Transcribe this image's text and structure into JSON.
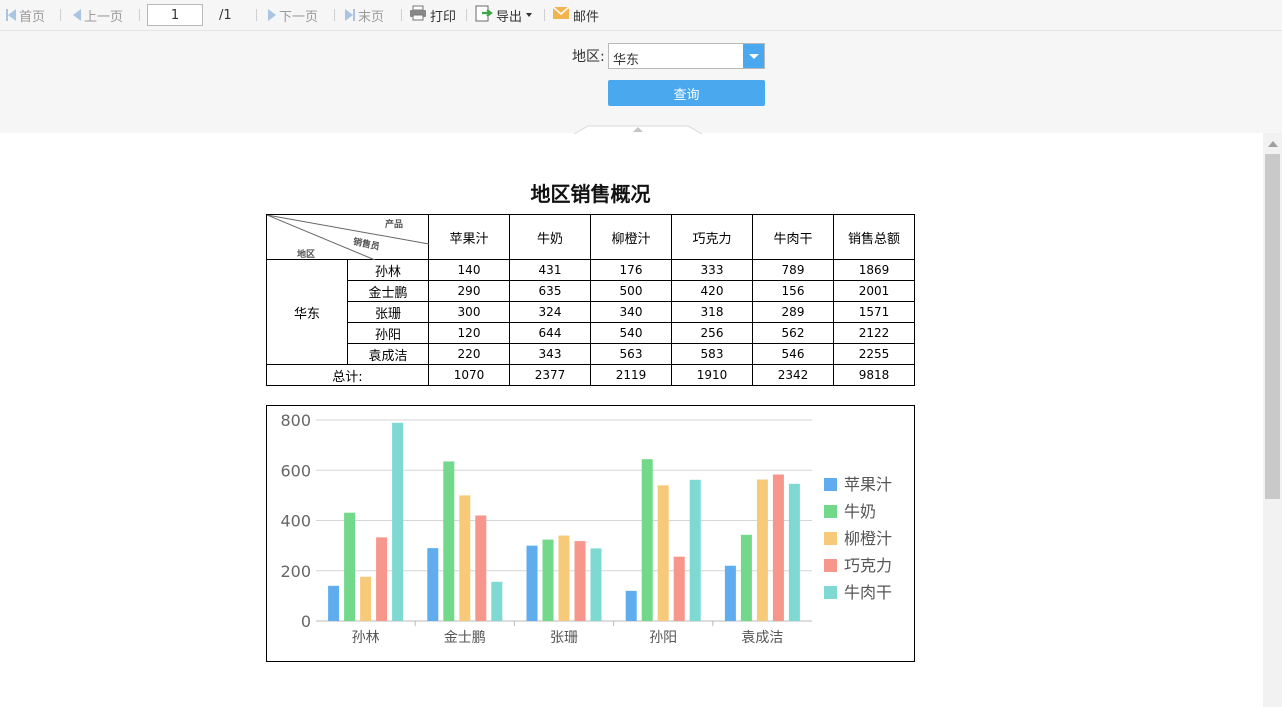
{
  "toolbar": {
    "first": "首页",
    "prev": "上一页",
    "page_value": "1",
    "page_total": "/1",
    "next": "下一页",
    "last": "末页",
    "print": "打印",
    "export": "导出",
    "mail": "邮件"
  },
  "params": {
    "region_label": "地区:",
    "region_value": "华东",
    "query_button": "查询"
  },
  "report": {
    "title": "地区销售概况",
    "corner": {
      "product": "产品",
      "salesperson": "销售员",
      "region": "地区"
    },
    "columns": [
      "苹果汁",
      "牛奶",
      "柳橙汁",
      "巧克力",
      "牛肉干",
      "销售总额"
    ],
    "region": "华东",
    "rows": [
      {
        "name": "孙林",
        "values": [
          "140",
          "431",
          "176",
          "333",
          "789",
          "1869"
        ]
      },
      {
        "name": "金士鹏",
        "values": [
          "290",
          "635",
          "500",
          "420",
          "156",
          "2001"
        ]
      },
      {
        "name": "张珊",
        "values": [
          "300",
          "324",
          "340",
          "318",
          "289",
          "1571"
        ]
      },
      {
        "name": "孙阳",
        "values": [
          "120",
          "644",
          "540",
          "256",
          "562",
          "2122"
        ]
      },
      {
        "name": "袁成洁",
        "values": [
          "220",
          "343",
          "563",
          "583",
          "546",
          "2255"
        ]
      }
    ],
    "total_label": "总计:",
    "totals": [
      "1070",
      "2377",
      "2119",
      "1910",
      "2342",
      "9818"
    ]
  },
  "chart_data": {
    "type": "bar",
    "categories": [
      "孙林",
      "金士鹏",
      "张珊",
      "孙阳",
      "袁成洁"
    ],
    "ylim": [
      0,
      800
    ],
    "yticks": [
      0,
      200,
      400,
      600,
      800
    ],
    "grid": true,
    "legend_position": "right",
    "series": [
      {
        "name": "苹果汁",
        "color": "#5fadee",
        "values": [
          140,
          290,
          300,
          120,
          220
        ]
      },
      {
        "name": "牛奶",
        "color": "#72d98b",
        "values": [
          431,
          635,
          324,
          644,
          343
        ]
      },
      {
        "name": "柳橙汁",
        "color": "#f7ca7a",
        "values": [
          176,
          500,
          340,
          540,
          563
        ]
      },
      {
        "name": "巧克力",
        "color": "#f7968a",
        "values": [
          333,
          420,
          318,
          256,
          583
        ]
      },
      {
        "name": "牛肉干",
        "color": "#7ed9d2",
        "values": [
          789,
          156,
          289,
          562,
          546
        ]
      }
    ]
  }
}
